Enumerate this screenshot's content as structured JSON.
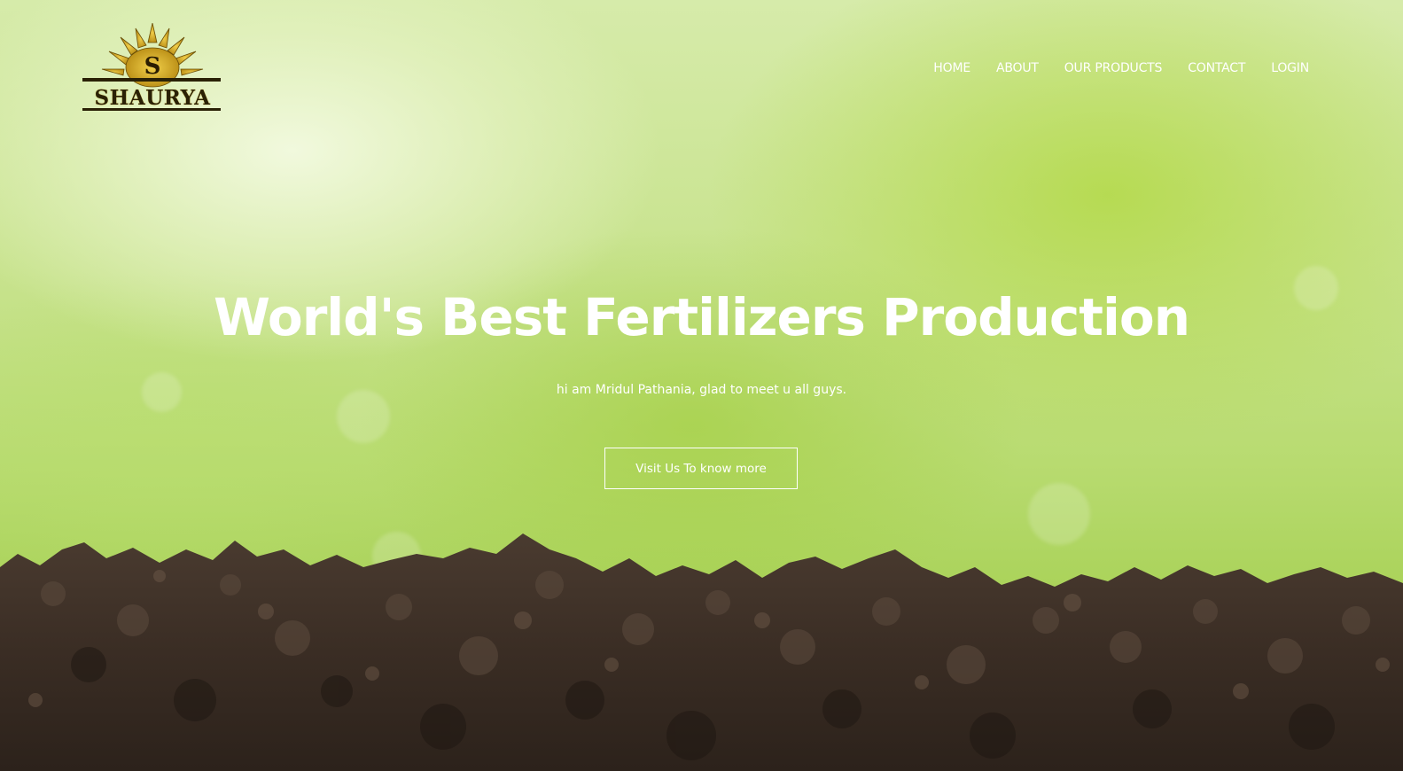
{
  "brand": {
    "name": "SHAURYA",
    "monogram": "S",
    "colors": {
      "gold": "#d3a51d",
      "dark": "#2a2106"
    }
  },
  "nav": {
    "items": [
      {
        "label": "HOME"
      },
      {
        "label": "ABOUT"
      },
      {
        "label": "OUR PRODUCTS"
      },
      {
        "label": "CONTACT"
      },
      {
        "label": "LOGIN"
      }
    ]
  },
  "hero": {
    "headline": "World's Best Fertilizers Production",
    "subtext": "hi am Mridul Pathania, glad to meet u all guys.",
    "cta_label": "Visit Us To know more"
  },
  "theme": {
    "text_color": "#ffffff",
    "grass_green": "#a9d258",
    "soil_brown": "#3b2e25"
  }
}
